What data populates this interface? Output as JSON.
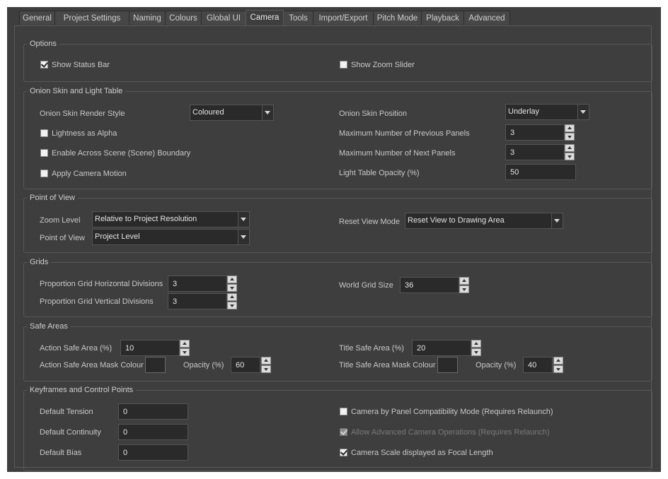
{
  "tabs": [
    "General",
    "Project Settings",
    "Naming",
    "Colours",
    "Global UI",
    "Camera",
    "Tools",
    "Import/Export",
    "Pitch Mode",
    "Playback",
    "Advanced"
  ],
  "active_tab": "Camera",
  "options": {
    "title": "Options",
    "show_status_bar": {
      "label": "Show Status Bar",
      "checked": true
    },
    "show_zoom_slider": {
      "label": "Show Zoom Slider",
      "checked": false
    }
  },
  "onion": {
    "title": "Onion Skin and Light Table",
    "render_style_label": "Onion Skin Render Style",
    "render_style_value": "Coloured",
    "lightness_alpha": "Lightness as Alpha",
    "across_boundary": "Enable Across Scene (Scene) Boundary",
    "camera_motion": "Apply Camera Motion",
    "position_label": "Onion Skin Position",
    "position_value": "Underlay",
    "prev_label": "Maximum Number of Previous Panels",
    "prev_value": "3",
    "next_label": "Maximum Number of Next Panels",
    "next_value": "3",
    "opacity_label": "Light Table Opacity (%)",
    "opacity_value": "50"
  },
  "pov": {
    "title": "Point of View",
    "zoom_label": "Zoom Level",
    "zoom_value": "Relative to Project Resolution",
    "pov_label": "Point of View",
    "pov_value": "Project Level",
    "reset_label": "Reset View Mode",
    "reset_value": "Reset View to Drawing Area"
  },
  "grids": {
    "title": "Grids",
    "h_label": "Proportion Grid Horizontal Divisions",
    "h_value": "3",
    "v_label": "Proportion Grid Vertical Divisions",
    "v_value": "3",
    "world_label": "World Grid Size",
    "world_value": "36"
  },
  "safe": {
    "title": "Safe Areas",
    "action_label": "Action Safe Area (%)",
    "action_value": "10",
    "action_mask_label": "Action Safe Area Mask Colour",
    "action_opacity_label": "Opacity (%)",
    "action_opacity_value": "60",
    "title_label": "Title Safe Area (%)",
    "title_value": "20",
    "title_mask_label": "Title Safe Area Mask Colour",
    "title_opacity_label": "Opacity (%)",
    "title_opacity_value": "40",
    "mask_swatch_color": "#2a2a2a"
  },
  "keyframes": {
    "title": "Keyframes and Control Points",
    "tension_label": "Default Tension",
    "tension_value": "0",
    "continuity_label": "Default Continuity",
    "continuity_value": "0",
    "bias_label": "Default Bias",
    "bias_value": "0",
    "panel_compat": "Camera by Panel Compatibility Mode (Requires Relaunch)",
    "advanced_ops": "Allow Advanced Camera Operations (Requires Relaunch)",
    "scale_focal": "Camera Scale displayed as Focal Length"
  }
}
